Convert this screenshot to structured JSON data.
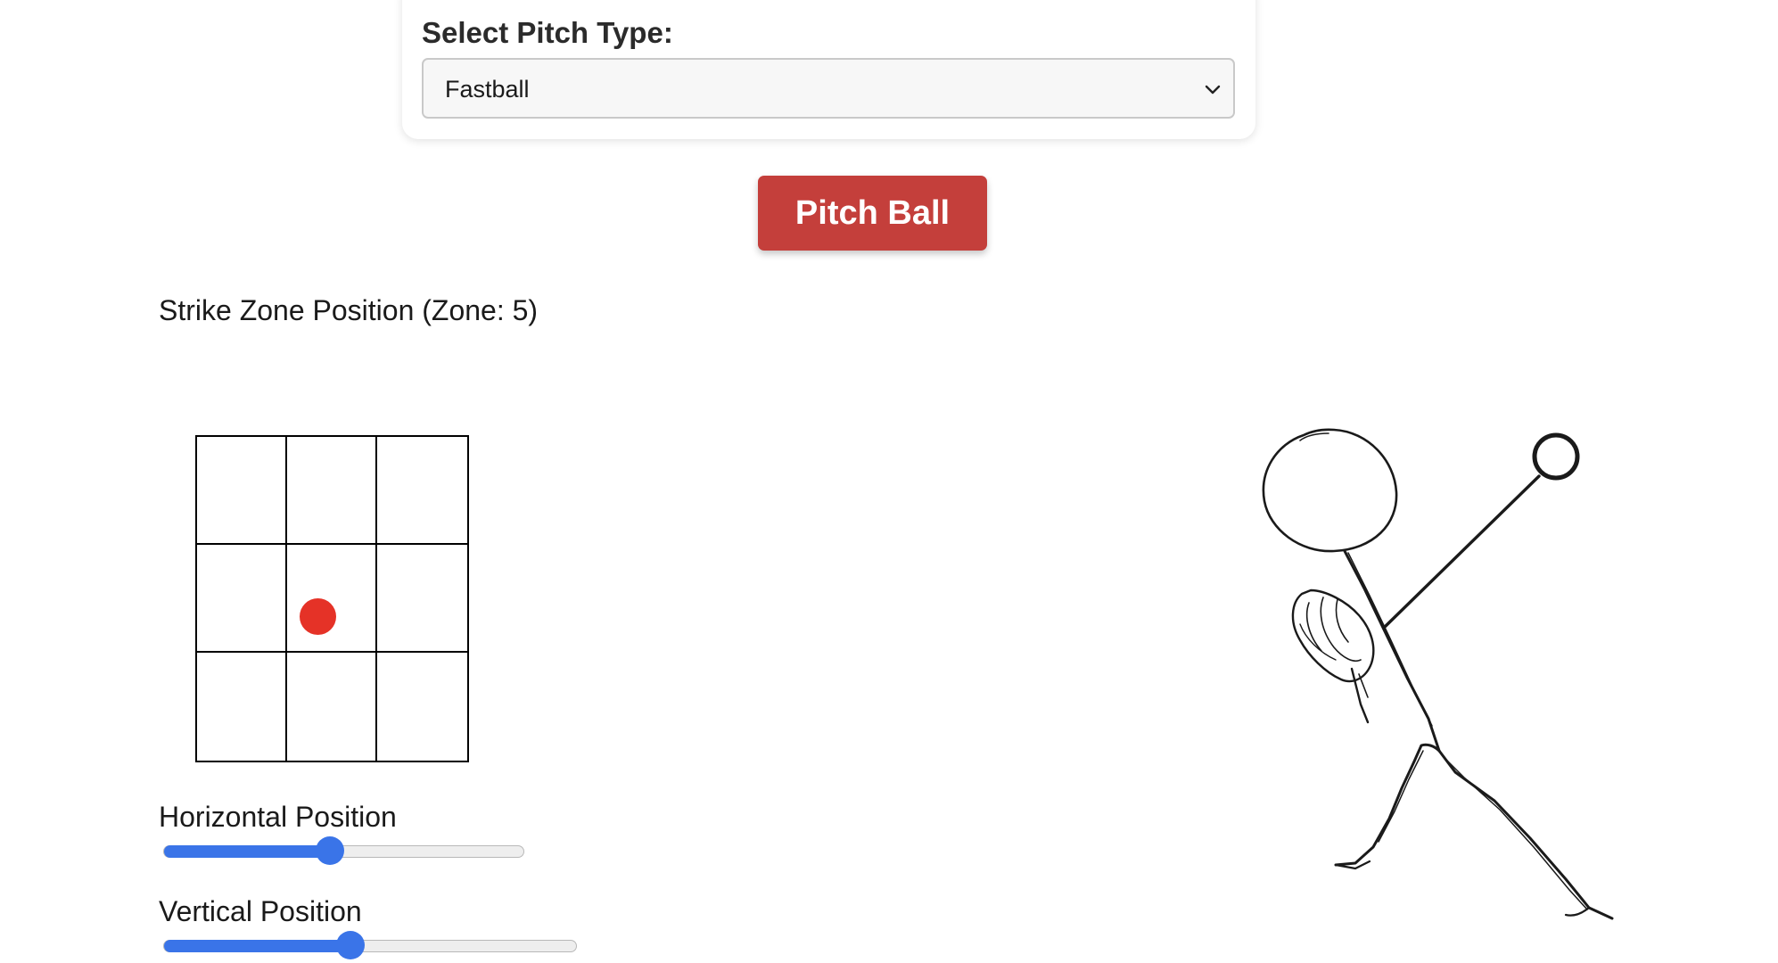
{
  "pitch_select": {
    "label": "Select Pitch Type:",
    "value": "Fastball"
  },
  "pitch_button": {
    "label": "Pitch Ball"
  },
  "strike_zone": {
    "label_prefix": "Strike Zone Position (Zone: ",
    "zone": "5",
    "label_suffix": ")",
    "ball_color": "#e53227"
  },
  "horizontal_slider": {
    "label": "Horizontal Position",
    "value_fraction": 0.46
  },
  "vertical_slider": {
    "label": "Vertical Position",
    "value_fraction": 0.45
  },
  "colors": {
    "accent": "#3a74e8",
    "button": "#c43f3b"
  }
}
